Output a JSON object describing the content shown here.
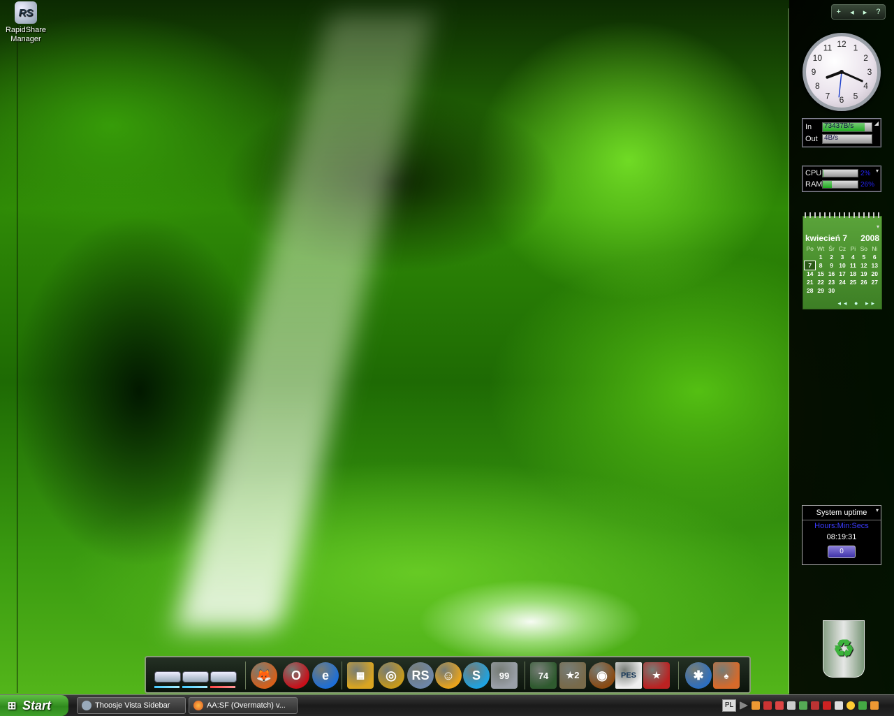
{
  "desktop": {
    "icons": [
      {
        "label": "RapidShare Manager",
        "glyph": "RS"
      },
      {
        "label": "",
        "glyph": "♻"
      }
    ]
  },
  "sidebar": {
    "controls": [
      "+",
      "◂",
      "▸",
      "?"
    ],
    "clock": {
      "numbers": [
        "12",
        "1",
        "2",
        "3",
        "4",
        "5",
        "6",
        "7",
        "8",
        "9",
        "10",
        "11"
      ],
      "hour": 8,
      "minute": 19,
      "second": 31
    },
    "network": {
      "in_label": "In",
      "in_value": "73437B/s",
      "out_label": "Out",
      "out_value": "4B/s",
      "in_fill": 0.85
    },
    "system": {
      "cpu_label": "CPU",
      "cpu_value": "2%",
      "cpu_fill": 0.02,
      "ram_label": "RAM",
      "ram_value": "26%",
      "ram_fill": 0.26
    },
    "calendar": {
      "month": "kwiecień 7",
      "year": "2008",
      "weekdays": [
        "Po",
        "Wt",
        "Śr",
        "Cz",
        "Pi",
        "So",
        "Ni"
      ],
      "weeks": [
        [
          "",
          "1",
          "2",
          "3",
          "4",
          "5",
          "6"
        ],
        [
          "7",
          "8",
          "9",
          "10",
          "11",
          "12",
          "13"
        ],
        [
          "14",
          "15",
          "16",
          "17",
          "18",
          "19",
          "20"
        ],
        [
          "21",
          "22",
          "23",
          "24",
          "25",
          "26",
          "27"
        ],
        [
          "28",
          "29",
          "30",
          "",
          "",
          "",
          ""
        ]
      ],
      "today": "7",
      "nav": "◂◂ ● ▸▸"
    },
    "uptime": {
      "title": "System uptime",
      "format": "Hours:Min:Secs",
      "value": "08:19:31",
      "button": "0"
    }
  },
  "dock": {
    "items": [
      {
        "name": "firefox",
        "glyph": "🦊"
      },
      {
        "name": "opera",
        "glyph": "O"
      },
      {
        "name": "internet-explorer",
        "glyph": "e"
      },
      {
        "name": "library",
        "glyph": "▦"
      },
      {
        "name": "cd-burner",
        "glyph": "◎"
      },
      {
        "name": "rapidshare",
        "glyph": "RS"
      },
      {
        "name": "smiley",
        "glyph": "☺"
      },
      {
        "name": "skype",
        "glyph": "S"
      },
      {
        "name": "monitor",
        "glyph": "99"
      },
      {
        "name": "game-74",
        "glyph": "74"
      },
      {
        "name": "game-star-2",
        "glyph": "★2"
      },
      {
        "name": "game-emblem",
        "glyph": "◉"
      },
      {
        "name": "pes",
        "glyph": "PES"
      },
      {
        "name": "america-army",
        "glyph": "★"
      },
      {
        "name": "spider-solitaire",
        "glyph": "✱"
      },
      {
        "name": "cards",
        "glyph": "♠"
      }
    ]
  },
  "taskbar": {
    "start_label": "Start",
    "tasks": [
      {
        "label": "Thoosje Vista Sidebar"
      },
      {
        "label": "AA:SF (Overmatch) v..."
      }
    ],
    "language": "PL",
    "colors": {
      "start": "#3fa02a",
      "bar": "#262626"
    }
  }
}
